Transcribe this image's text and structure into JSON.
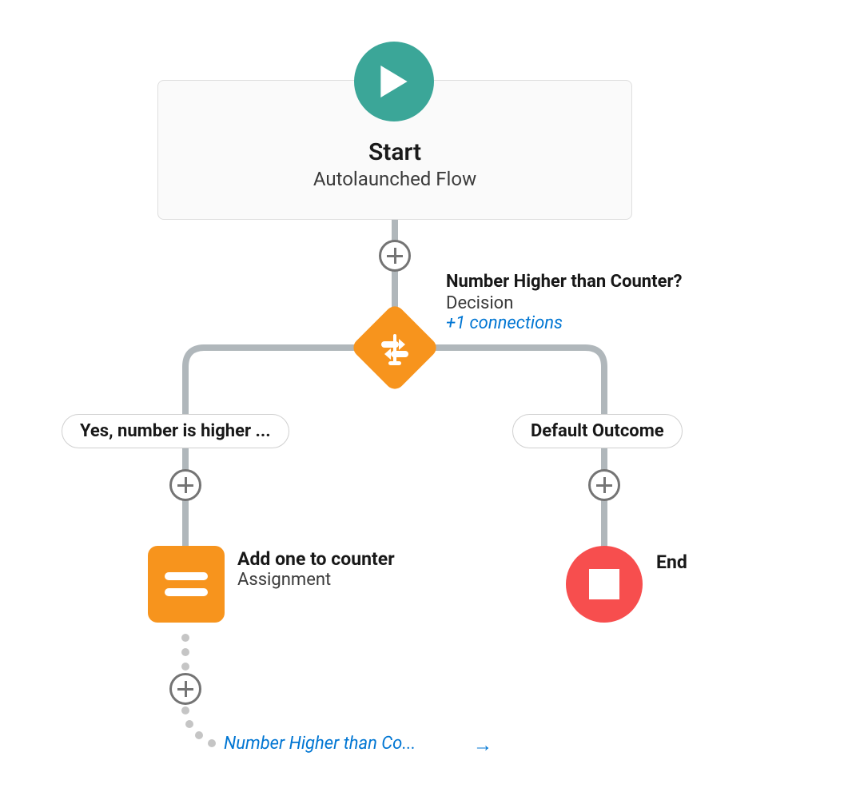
{
  "start": {
    "title": "Start",
    "subtitle": "Autolaunched Flow"
  },
  "decision": {
    "title": "Number Higher than Counter?",
    "type": "Decision",
    "connections_label": "+1 connections"
  },
  "outcomes": {
    "left_label": "Yes, number is higher ...",
    "right_label": "Default Outcome"
  },
  "assignment": {
    "title": "Add one to counter",
    "type": "Assignment"
  },
  "end": {
    "label": "End"
  },
  "loop_back": {
    "link_label": "Number Higher than Co...",
    "arrow": "→"
  },
  "icons": {
    "play": "play-icon",
    "plus": "plus-icon",
    "decision": "decision-icon",
    "assignment": "assignment-icon",
    "end": "stop-icon"
  },
  "colors": {
    "teal": "#3BA698",
    "orange": "#F7941D",
    "red": "#F74E4E",
    "link": "#0176D3",
    "connector": "#B0B7BB"
  }
}
